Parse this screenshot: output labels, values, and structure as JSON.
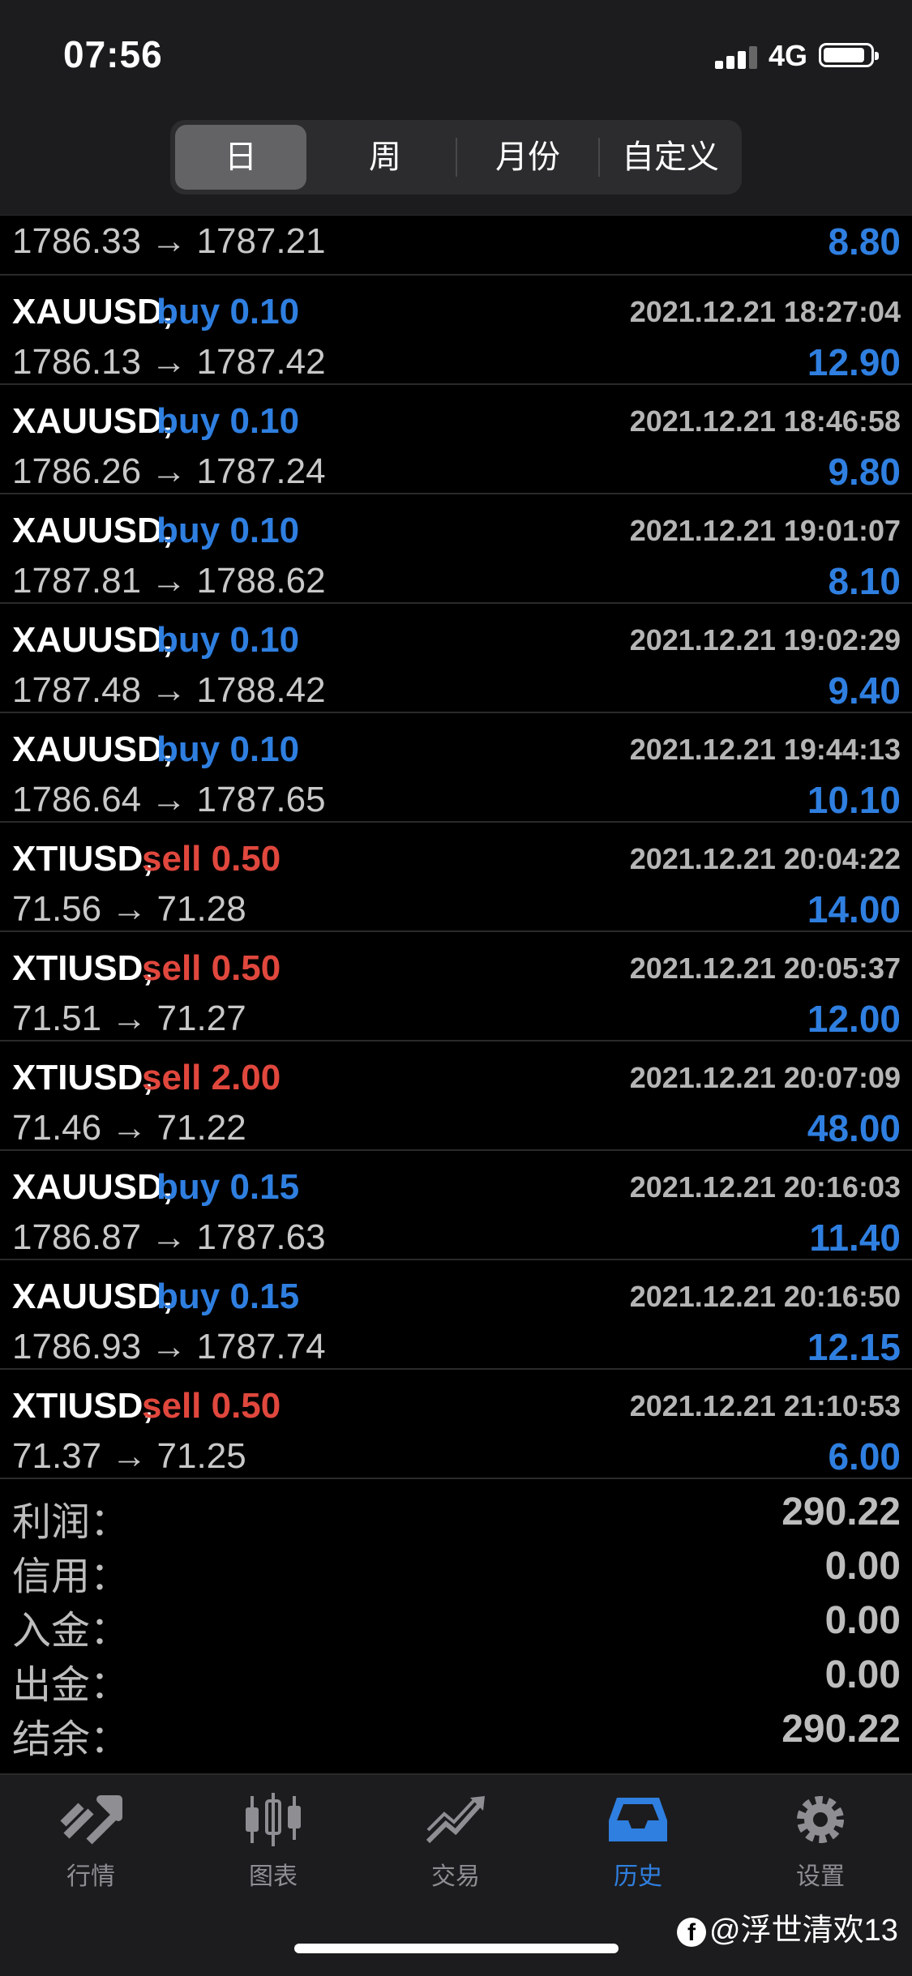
{
  "status_bar": {
    "time": "07:56",
    "network": "4G"
  },
  "period_tabs": [
    {
      "label": "日",
      "active": true
    },
    {
      "label": "周",
      "active": false
    },
    {
      "label": "月份",
      "active": false
    },
    {
      "label": "自定义",
      "active": false
    }
  ],
  "trades": [
    {
      "prices": "1786.33 → 1787.21",
      "profit": "8.80"
    },
    {
      "symbol": "XAUUSD,",
      "side": "buy 0.10",
      "type": "buy",
      "time": "2021.12.21 18:27:04",
      "prices": "1786.13 → 1787.42",
      "profit": "12.90"
    },
    {
      "symbol": "XAUUSD,",
      "side": "buy 0.10",
      "type": "buy",
      "time": "2021.12.21 18:46:58",
      "prices": "1786.26 → 1787.24",
      "profit": "9.80"
    },
    {
      "symbol": "XAUUSD,",
      "side": "buy 0.10",
      "type": "buy",
      "time": "2021.12.21 19:01:07",
      "prices": "1787.81 → 1788.62",
      "profit": "8.10"
    },
    {
      "symbol": "XAUUSD,",
      "side": "buy 0.10",
      "type": "buy",
      "time": "2021.12.21 19:02:29",
      "prices": "1787.48 → 1788.42",
      "profit": "9.40"
    },
    {
      "symbol": "XAUUSD,",
      "side": "buy 0.10",
      "type": "buy",
      "time": "2021.12.21 19:44:13",
      "prices": "1786.64 → 1787.65",
      "profit": "10.10"
    },
    {
      "symbol": "XTIUSD,",
      "side": "sell 0.50",
      "type": "sell",
      "time": "2021.12.21 20:04:22",
      "prices": "71.56 → 71.28",
      "profit": "14.00"
    },
    {
      "symbol": "XTIUSD,",
      "side": "sell 0.50",
      "type": "sell",
      "time": "2021.12.21 20:05:37",
      "prices": "71.51 → 71.27",
      "profit": "12.00"
    },
    {
      "symbol": "XTIUSD,",
      "side": "sell 2.00",
      "type": "sell",
      "time": "2021.12.21 20:07:09",
      "prices": "71.46 → 71.22",
      "profit": "48.00"
    },
    {
      "symbol": "XAUUSD,",
      "side": "buy 0.15",
      "type": "buy",
      "time": "2021.12.21 20:16:03",
      "prices": "1786.87 → 1787.63",
      "profit": "11.40"
    },
    {
      "symbol": "XAUUSD,",
      "side": "buy 0.15",
      "type": "buy",
      "time": "2021.12.21 20:16:50",
      "prices": "1786.93 → 1787.74",
      "profit": "12.15"
    },
    {
      "symbol": "XTIUSD,",
      "side": "sell 0.50",
      "type": "sell",
      "time": "2021.12.21 21:10:53",
      "prices": "71.37 → 71.25",
      "profit": "6.00"
    }
  ],
  "summary": [
    {
      "label": "利润：",
      "value": "290.22"
    },
    {
      "label": "信用：",
      "value": "0.00"
    },
    {
      "label": "入金：",
      "value": "0.00"
    },
    {
      "label": "出金：",
      "value": "0.00"
    },
    {
      "label": "结余：",
      "value": "290.22"
    }
  ],
  "tab_bar": [
    {
      "label": "行情",
      "icon": "quotes-icon",
      "active": false
    },
    {
      "label": "图表",
      "icon": "chart-icon",
      "active": false
    },
    {
      "label": "交易",
      "icon": "trade-icon",
      "active": false
    },
    {
      "label": "历史",
      "icon": "history-icon",
      "active": true
    },
    {
      "label": "设置",
      "icon": "settings-icon",
      "active": false
    }
  ],
  "watermark": {
    "text": "@浮世清欢13"
  },
  "colors": {
    "buy": "#2f7fe0",
    "sell": "#e0473d",
    "active_tab": "#2f7fe0"
  }
}
